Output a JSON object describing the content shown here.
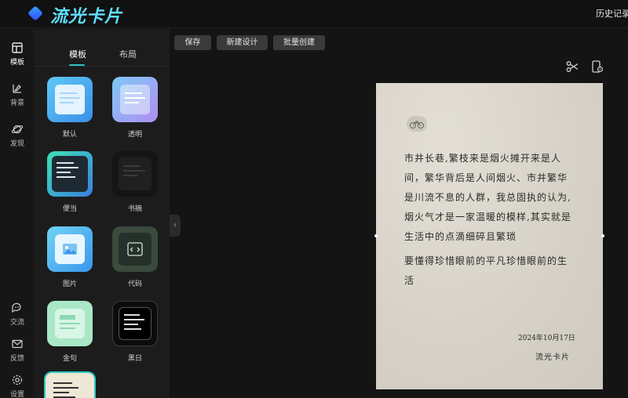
{
  "app": {
    "title": "流光卡片",
    "history_label": "历史记录"
  },
  "rail": {
    "top_items": [
      {
        "label": "模板",
        "icon": "template-icon"
      },
      {
        "label": "背景",
        "icon": "background-icon"
      },
      {
        "label": "发现",
        "icon": "planet-icon"
      }
    ],
    "bottom_items": [
      {
        "label": "交流",
        "icon": "chat-icon"
      },
      {
        "label": "反馈",
        "icon": "mail-icon"
      },
      {
        "label": "设置",
        "icon": "gear-icon"
      }
    ]
  },
  "panel": {
    "tabs": [
      {
        "label": "模板",
        "active": true
      },
      {
        "label": "布局",
        "active": false
      }
    ],
    "templates": [
      {
        "label": "默认"
      },
      {
        "label": "透明"
      },
      {
        "label": "便当"
      },
      {
        "label": "书摘"
      },
      {
        "label": "图片"
      },
      {
        "label": "代码"
      },
      {
        "label": "金句"
      },
      {
        "label": "黑日"
      }
    ]
  },
  "toolbar": {
    "save_label": "保存",
    "new_label": "新建设计",
    "batch_label": "批量创建"
  },
  "card": {
    "icon": "bicycle-icon",
    "paragraphs": [
      "市井长巷,繁枝来是烟火摊开来是人间，繁华背后是人间烟火、市井繁华是川流不息的人群，我总固执的认为,烟火气才是一家温暖的模样,其实就是生活中的点滴细碎且繁琐",
      "要懂得珍惜眼前的平凡珍惜眼前的生活"
    ],
    "date": "2024年10月17日",
    "signature": "流光卡片"
  },
  "colors": {
    "accent": "#2bc5c0",
    "logo": "#5fe0ff",
    "card_bg": "#d9d4c9"
  }
}
